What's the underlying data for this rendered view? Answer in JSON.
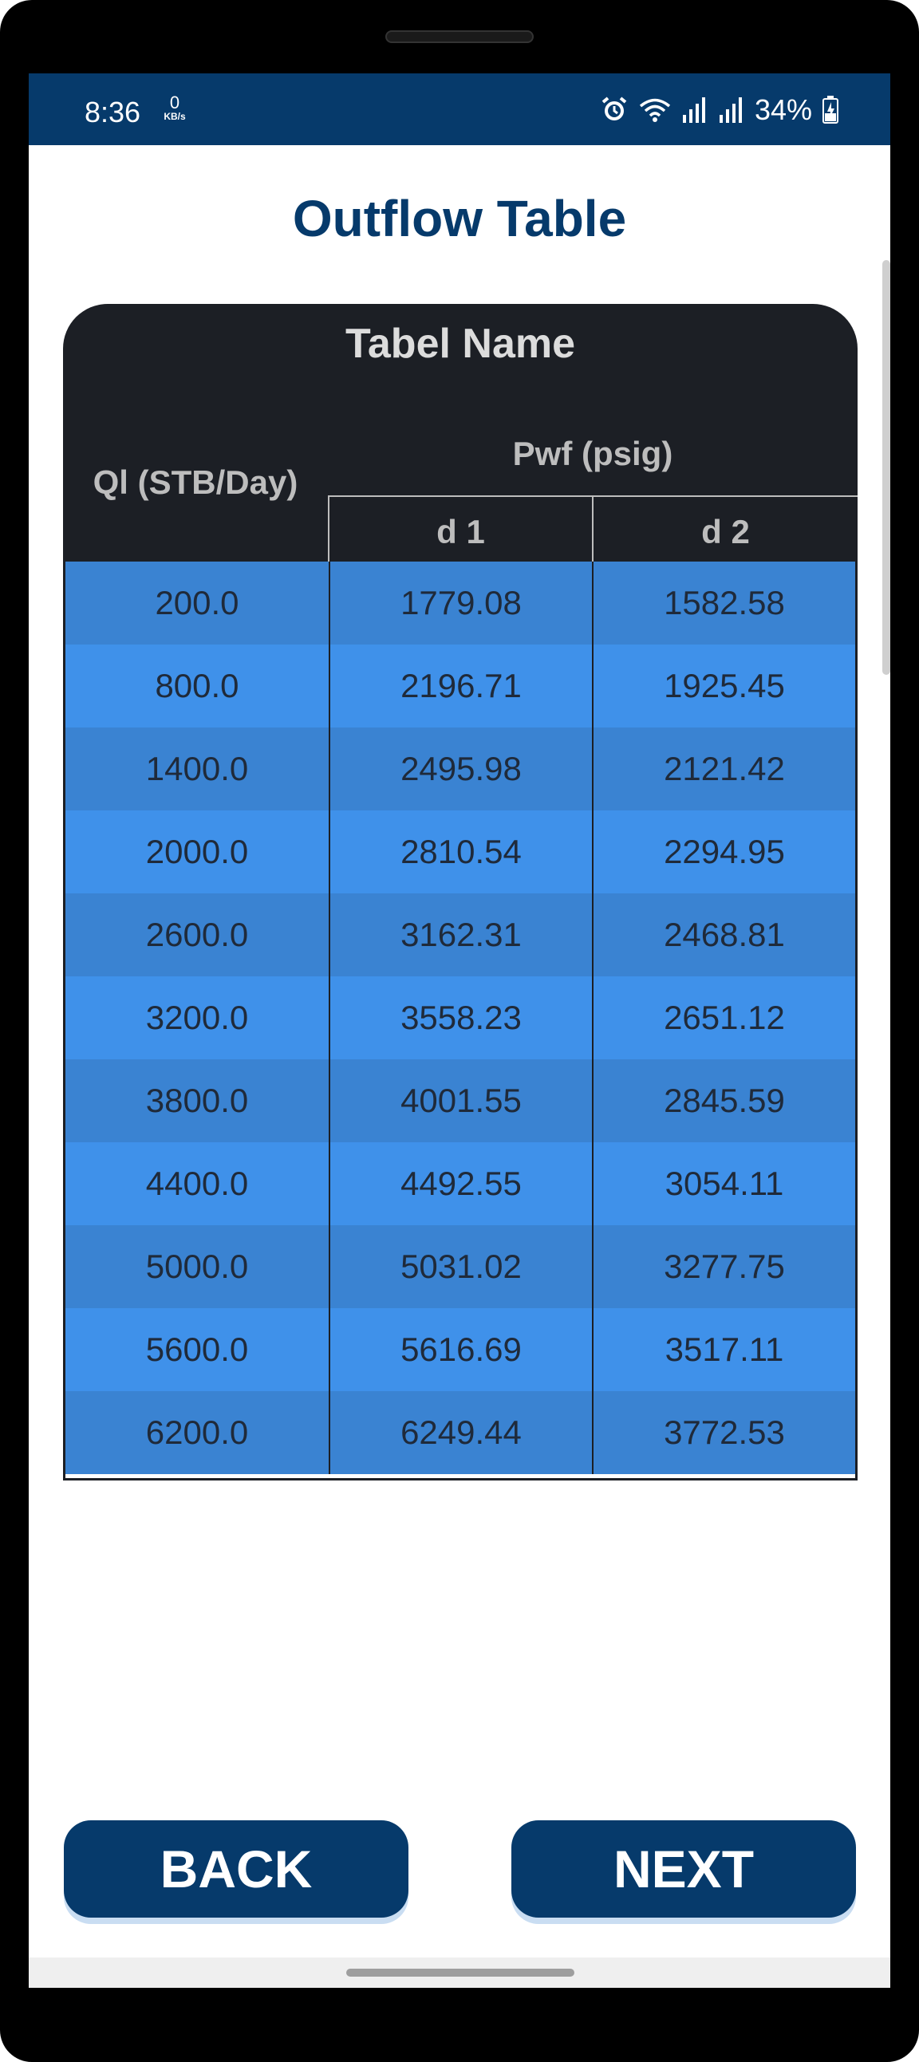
{
  "status_bar": {
    "time": "8:36",
    "net_speed_value": "0",
    "net_speed_unit": "KB/s",
    "battery_percent": "34%",
    "icons": [
      "alarm-icon",
      "wifi-icon",
      "signal-icon",
      "signal-icon",
      "battery-charging-icon"
    ]
  },
  "page": {
    "title": "Outflow Table"
  },
  "table": {
    "name": "Tabel Name",
    "col_ql_header": "Ql (STB/Day)",
    "col_pwf_header": "Pwf (psig)",
    "sub_headers": [
      "d 1",
      "d 2"
    ],
    "rows": [
      [
        "200.0",
        "1779.08",
        "1582.58"
      ],
      [
        "800.0",
        "2196.71",
        "1925.45"
      ],
      [
        "1400.0",
        "2495.98",
        "2121.42"
      ],
      [
        "2000.0",
        "2810.54",
        "2294.95"
      ],
      [
        "2600.0",
        "3162.31",
        "2468.81"
      ],
      [
        "3200.0",
        "3558.23",
        "2651.12"
      ],
      [
        "3800.0",
        "4001.55",
        "2845.59"
      ],
      [
        "4400.0",
        "4492.55",
        "3054.11"
      ],
      [
        "5000.0",
        "5031.02",
        "3277.75"
      ],
      [
        "5600.0",
        "5616.69",
        "3517.11"
      ],
      [
        "6200.0",
        "6249.44",
        "3772.53"
      ]
    ]
  },
  "buttons": {
    "back_label": "BACK",
    "next_label": "NEXT"
  },
  "colors": {
    "primary": "#063a6b",
    "header_bg": "#1c1f25",
    "row_dark": "#3a83d2",
    "row_light": "#3f91ea"
  }
}
